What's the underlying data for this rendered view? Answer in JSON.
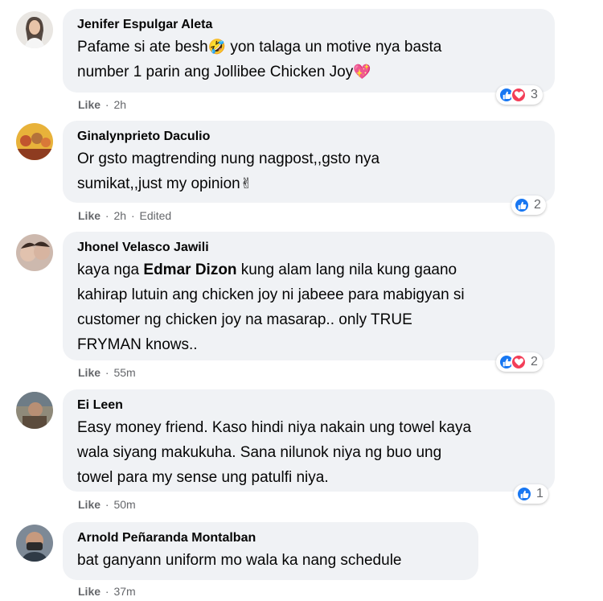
{
  "comments": [
    {
      "author": "Jenifer Espulgar Aleta",
      "line1": "Pafame si ate besh",
      "line1_emoji": "🤣",
      "line1_rest": " yon talaga un motive nya basta",
      "line2": "number 1 parin ang Jollibee Chicken Joy",
      "line2_emoji": "💖",
      "like": "Like",
      "time": "2h",
      "reaction_count": "3",
      "reactions": [
        "like-icon",
        "love-icon"
      ]
    },
    {
      "author": "Ginalynprieto Daculio",
      "line1": "Or gsto magtrending nung nagpost,,gsto nya",
      "line2": "sumikat,,just my opinion",
      "line2_emoji": "✌",
      "like": "Like",
      "time": "2h",
      "edited": "Edited",
      "reaction_count": "2",
      "reactions": [
        "like-icon"
      ]
    },
    {
      "author": "Jhonel Velasco Jawili",
      "line1_pre": "kaya nga ",
      "mention": "Edmar Dizon",
      "line1_post": " kung alam lang nila kung gaano",
      "line2": "kahirap lutuin ang chicken joy ni jabeee para mabigyan si",
      "line3": "customer ng chicken joy na masarap.. only TRUE",
      "line4": "FRYMAN knows..",
      "like": "Like",
      "time": "55m",
      "reaction_count": "2",
      "reactions": [
        "like-icon",
        "love-icon"
      ]
    },
    {
      "author": "Ei Leen",
      "line1": "Easy money friend. Kaso hindi niya nakain ung towel kaya",
      "line2": "wala siyang makukuha. Sana nilunok niya ng buo ung",
      "line3": "towel para my sense ung patulfi niya.",
      "like": "Like",
      "time": "50m",
      "reaction_count": "1",
      "reactions": [
        "like-icon"
      ]
    },
    {
      "author": "Arnold Peñaranda Montalban",
      "line1": "bat ganyann uniform mo wala ka nang schedule",
      "like": "Like",
      "time": "37m"
    }
  ],
  "colors": {
    "like_blue": "#1877f2",
    "love_red": "#f33e58",
    "bubble": "#f0f2f5",
    "meta_gray": "#65676b"
  }
}
